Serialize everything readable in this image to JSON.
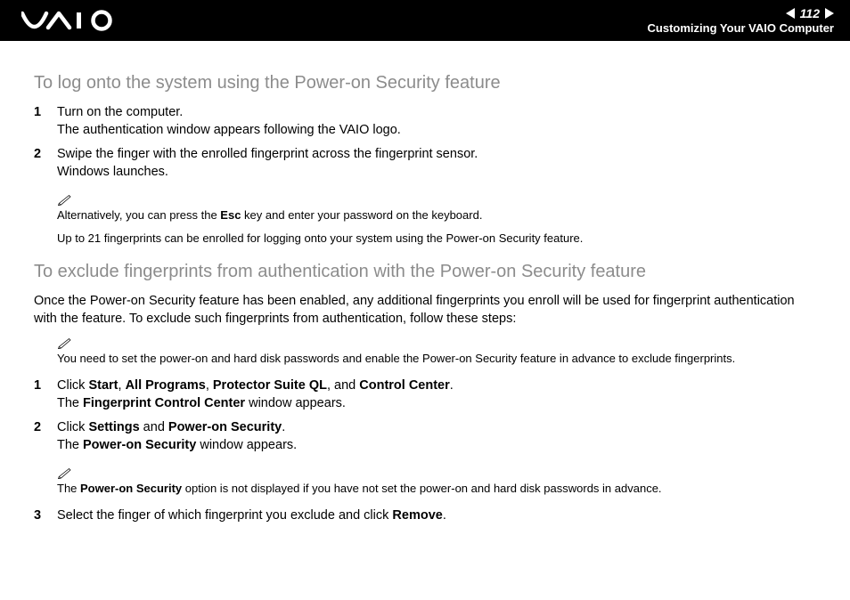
{
  "header": {
    "page_number": "112",
    "section_title": "Customizing Your VAIO Computer"
  },
  "sections": {
    "h1": "To log onto the system using the Power-on Security feature",
    "steps1": [
      {
        "num": "1",
        "line1": "Turn on the computer.",
        "line2": "The authentication window appears following the VAIO logo."
      },
      {
        "num": "2",
        "line1": "Swipe the finger with the enrolled fingerprint across the fingerprint sensor.",
        "line2": "Windows launches."
      }
    ],
    "note1_pre": "Alternatively, you can press the ",
    "note1_bold": "Esc",
    "note1_post": " key and enter your password on the keyboard.",
    "note1b": "Up to 21 fingerprints can be enrolled for logging onto your system using the Power-on Security feature.",
    "h2": "To exclude fingerprints from authentication with the Power-on Security feature",
    "para2": "Once the Power-on Security feature has been enabled, any additional fingerprints you enroll will be used for fingerprint authentication with the feature. To exclude such fingerprints from authentication, follow these steps:",
    "note2": "You need to set the power-on and hard disk passwords and enable the Power-on Security feature in advance to exclude fingerprints.",
    "steps2": {
      "s1": {
        "num": "1",
        "pre": "Click ",
        "b1": "Start",
        "c1": ", ",
        "b2": "All Programs",
        "c2": ", ",
        "b3": "Protector Suite QL",
        "c3": ", and ",
        "b4": "Control Center",
        "c4": ".",
        "line2_pre": "The ",
        "line2_b": "Fingerprint Control Center",
        "line2_post": " window appears."
      },
      "s2": {
        "num": "2",
        "pre": "Click ",
        "b1": "Settings",
        "c1": " and ",
        "b2": "Power-on Security",
        "c2": ".",
        "line2_pre": "The ",
        "line2_b": "Power-on Security",
        "line2_post": " window appears."
      },
      "s3": {
        "num": "3",
        "pre": "Select the finger of which fingerprint you exclude and click ",
        "b1": "Remove",
        "c1": "."
      }
    },
    "note3_pre": "The ",
    "note3_b": "Power-on Security",
    "note3_post": " option is not displayed if you have not set the power-on and hard disk passwords in advance."
  }
}
